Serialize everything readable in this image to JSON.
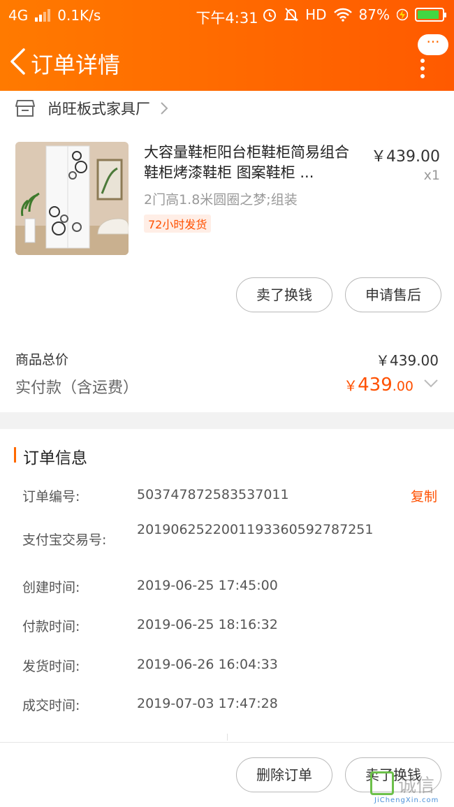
{
  "status_bar": {
    "network": "4G",
    "speed": "0.1K/s",
    "time": "下午4:31",
    "hd": "HD",
    "battery": "87%",
    "battery_level": 0.87
  },
  "nav": {
    "title": "订单详情",
    "more_bubble": "···"
  },
  "shop": {
    "name": "尚旺板式家具厂"
  },
  "product": {
    "title": "大容量鞋柜阳台柜鞋柜简易组合鞋柜烤漆鞋柜 图案鞋柜 ...",
    "price": "￥439.00",
    "qty": "x1",
    "spec": "2门高1.8米圆圈之梦;组装",
    "tag": "72小时发货"
  },
  "actions": {
    "sell": "卖了换钱",
    "after_sale": "申请售后"
  },
  "totals": {
    "goods_label": "商品总价",
    "goods_value": "￥439.00",
    "paid_label": "实付款（含运费）",
    "paid_currency": "￥",
    "paid_int": "439",
    "paid_dec": ".00"
  },
  "order_info": {
    "title": "订单信息",
    "copy": "复制",
    "rows": [
      {
        "label": "订单编号:",
        "value": "503747872583537011"
      },
      {
        "label": "支付宝交易号:",
        "value": "2019062522001193360592787251"
      },
      {
        "label": "创建时间:",
        "value": "2019-06-25 17:45:00"
      },
      {
        "label": "付款时间:",
        "value": "2019-06-25 18:16:32"
      },
      {
        "label": "发货时间:",
        "value": "2019-06-26 16:04:33"
      },
      {
        "label": "成交时间:",
        "value": "2019-07-03 17:47:28"
      }
    ]
  },
  "bottom": {
    "delete": "删除订单",
    "sell": "卖了换钱"
  },
  "watermark": {
    "text": "诚信",
    "sub": "JiChengXin.com"
  },
  "colors": {
    "accent": "#ff5000",
    "header_start": "#ff7a00",
    "header_end": "#ff5a00"
  }
}
